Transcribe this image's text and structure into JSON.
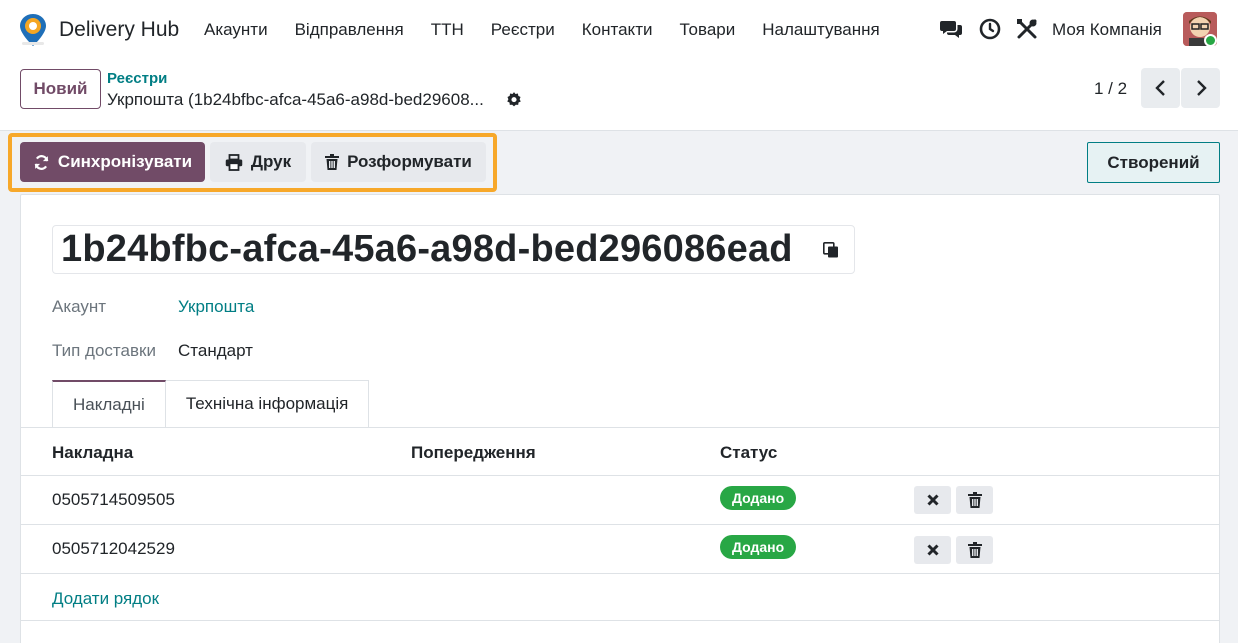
{
  "navbar": {
    "app_name": "Delivery Hub",
    "menu": [
      "Акаунти",
      "Відправлення",
      "ТТН",
      "Реєстри",
      "Контакти",
      "Товари",
      "Налаштування"
    ],
    "company": "Моя Компанія"
  },
  "control_panel": {
    "new_label": "Новий",
    "breadcrumb_parent": "Реєстри",
    "breadcrumb_current": "Укрпошта (1b24bfbc-afca-45a6-a98d-bed29608...",
    "pager": "1 / 2"
  },
  "actions": {
    "sync": "Синхронізувати",
    "print": "Друк",
    "unform": "Розформувати",
    "state": "Створений"
  },
  "record": {
    "title": "1b24bfbc-afca-45a6-a98d-bed296086ead",
    "fields": [
      {
        "label": "Акаунт",
        "value": "Укрпошта"
      },
      {
        "label": "Тип доставки",
        "value": "Стандарт"
      }
    ]
  },
  "tabs": [
    "Накладні",
    "Технічна інформація"
  ],
  "table": {
    "headers": [
      "Накладна",
      "Попередження",
      "Статус"
    ],
    "rows": [
      {
        "number": "0505714509505",
        "warning": "",
        "status": "Додано"
      },
      {
        "number": "0505712042529",
        "warning": "",
        "status": "Додано"
      }
    ],
    "add_line": "Додати рядок"
  },
  "colors": {
    "primary": "#714b67",
    "link": "#017e84",
    "success": "#28a745",
    "highlight": "#f7a82a"
  }
}
